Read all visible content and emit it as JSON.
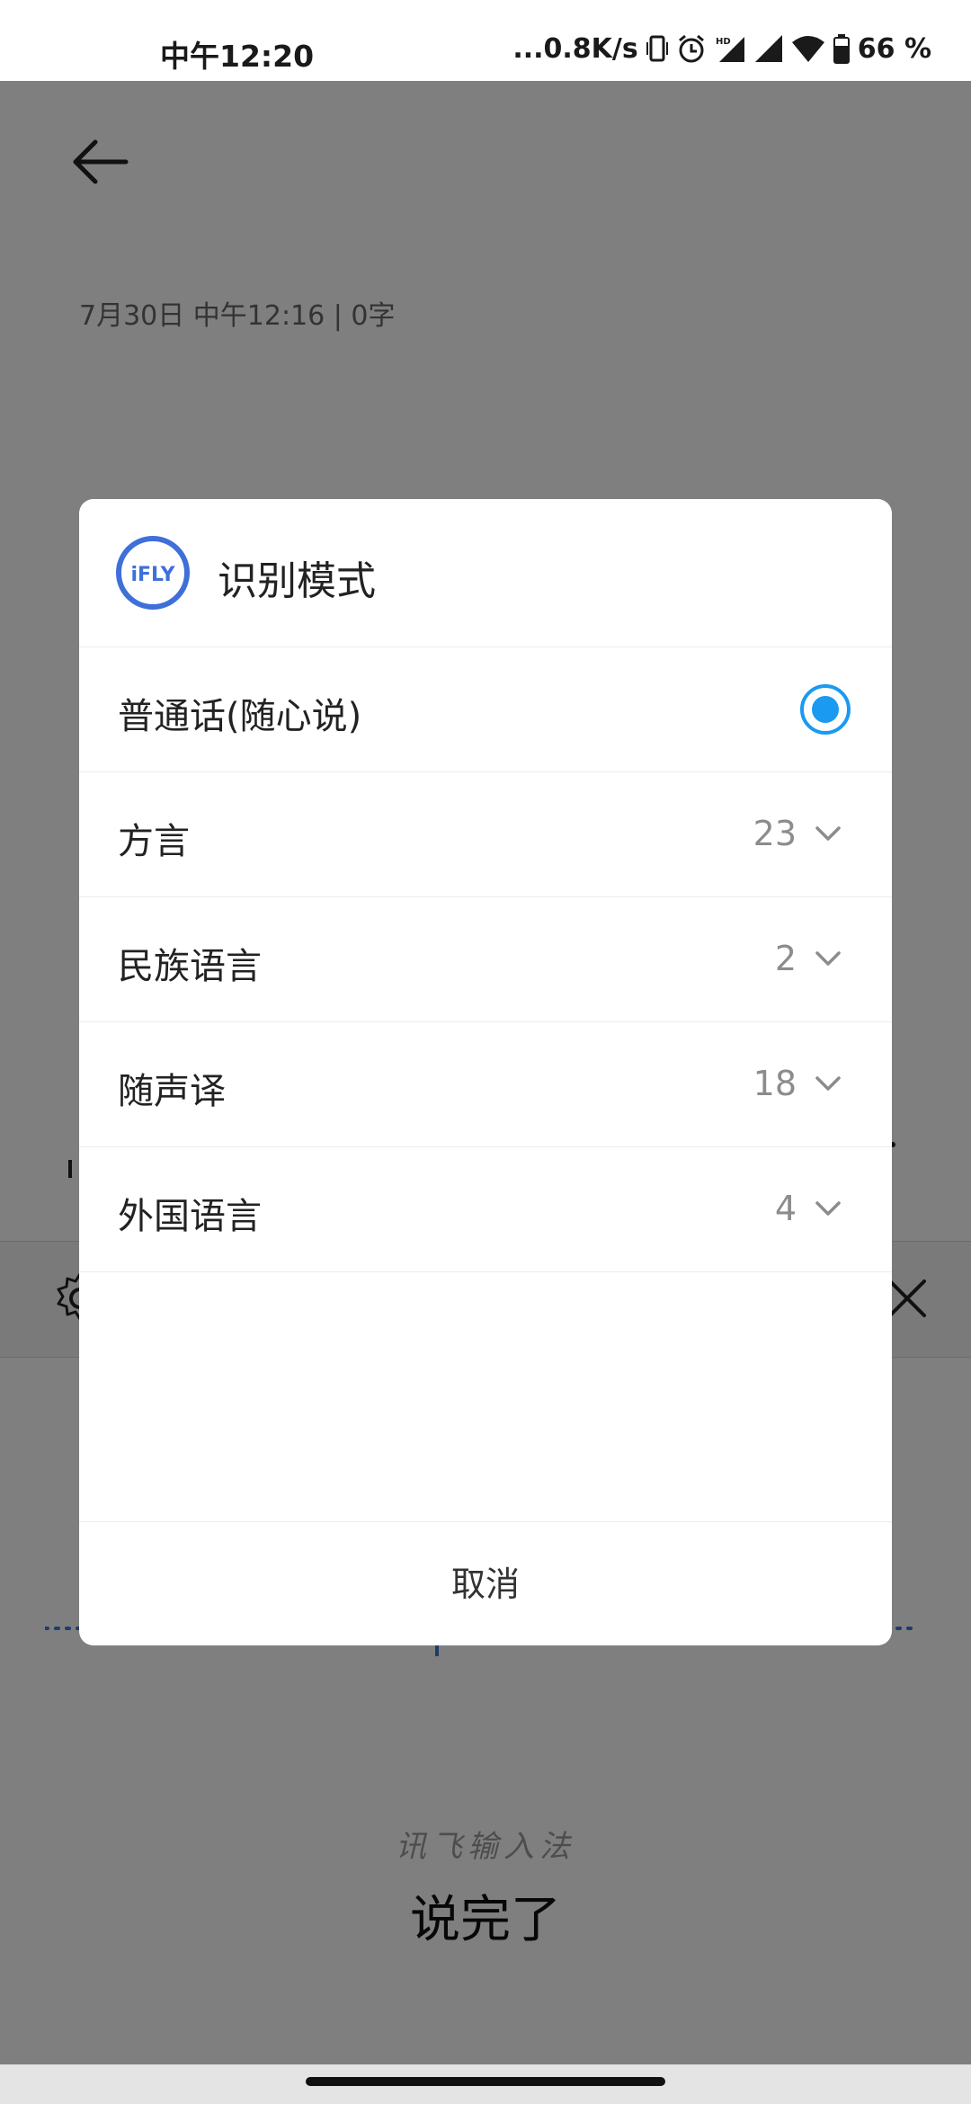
{
  "status_bar": {
    "time": "中午12:20",
    "net_speed": "...0.8K/s",
    "battery": "66",
    "battery_unit": "%",
    "icons": [
      "vibrate-icon",
      "alarm-icon",
      "hd-signal-icon",
      "signal-icon",
      "wifi-icon",
      "battery-icon"
    ]
  },
  "page": {
    "meta": "7月30日  中午12:16  |  0字",
    "ime_brand": "讯飞输入法",
    "done_label": "说完了"
  },
  "dialog": {
    "title": "识别模式",
    "logo_text": "iFLY",
    "items": [
      {
        "label": "普通话(随心说)",
        "selected": true
      },
      {
        "label": "方言",
        "count": "23"
      },
      {
        "label": "民族语言",
        "count": "2"
      },
      {
        "label": "随声译",
        "count": "18"
      },
      {
        "label": "外国语言",
        "count": "4"
      }
    ],
    "cancel_label": "取消"
  },
  "colors": {
    "accent": "#1a9af0",
    "logo_blue": "#3f6fd8",
    "scrim": "rgba(0,0,0,0.5)"
  }
}
